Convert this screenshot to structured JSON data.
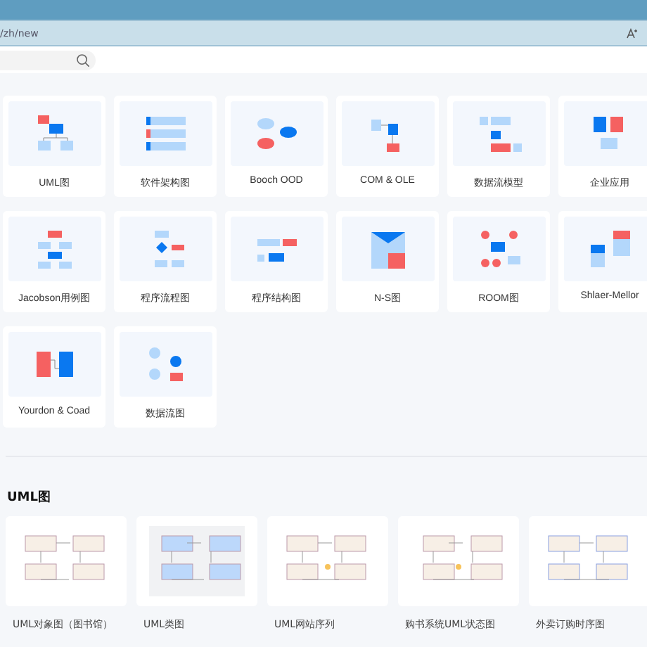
{
  "browser": {
    "url": "/zh/new"
  },
  "diagram_types": [
    {
      "label": "UML图"
    },
    {
      "label": "软件架构图"
    },
    {
      "label": "Booch OOD"
    },
    {
      "label": "COM & OLE"
    },
    {
      "label": "数据流模型"
    },
    {
      "label": "企业应用"
    },
    {
      "label": "Jacobson用例图"
    },
    {
      "label": "程序流程图"
    },
    {
      "label": "程序结构图"
    },
    {
      "label": "N-S图"
    },
    {
      "label": "ROOM图"
    },
    {
      "label": "Shlaer-Mellor"
    },
    {
      "label": "Yourdon & Coad"
    },
    {
      "label": "数据流图"
    }
  ],
  "templates_section": {
    "title": "UML图",
    "templates": [
      {
        "label": "UML对象图（图书馆）"
      },
      {
        "label": "UML类图"
      },
      {
        "label": "UML网站序列"
      },
      {
        "label": "购书系统UML状态图"
      },
      {
        "label": "外卖订购时序图"
      }
    ]
  }
}
